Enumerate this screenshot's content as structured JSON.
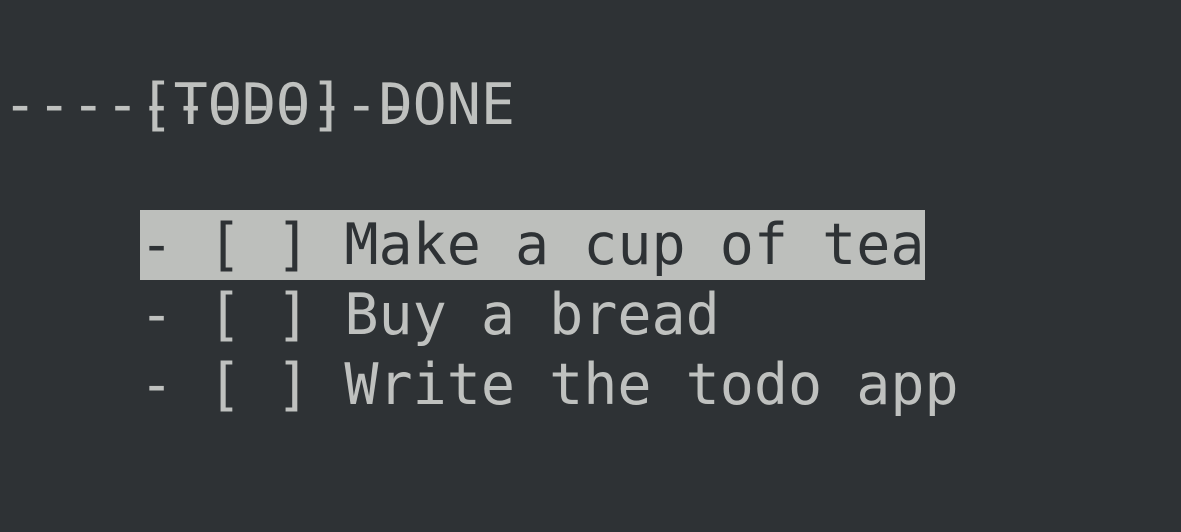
{
  "tabs": [
    {
      "label": "[TODO]",
      "active": true
    },
    {
      "label": "DONE",
      "active": false
    }
  ],
  "separator": "------------",
  "items": [
    {
      "bullet": "-",
      "checkbox": "[ ]",
      "label": "Make a cup of tea",
      "selected": true
    },
    {
      "bullet": "-",
      "checkbox": "[ ]",
      "label": "Buy a bread",
      "selected": false
    },
    {
      "bullet": "-",
      "checkbox": "[ ]",
      "label": "Write the todo app",
      "selected": false
    }
  ],
  "colors": {
    "background": "#2e3235",
    "foreground": "#bfc1bf",
    "highlight": "#bdbfbc"
  }
}
